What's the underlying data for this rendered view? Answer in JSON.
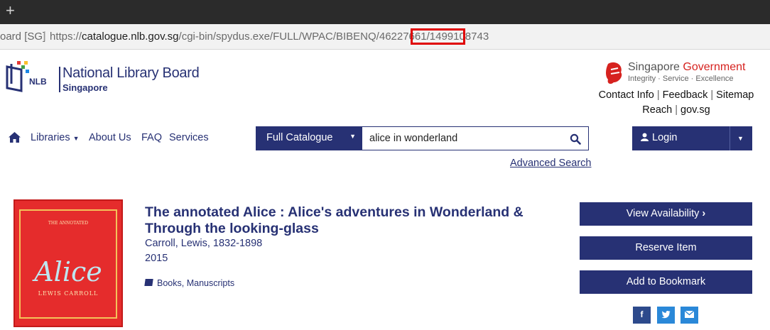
{
  "browser": {
    "new_tab": "+",
    "site_label": "oard [SG]",
    "url_prefix": "https://",
    "url_host": "catalogue.nlb.gov.sg",
    "url_path": "/cgi-bin/spydus.exe/FULL/WPAC/BIBENQ/46227661/1499108743",
    "highlight_color": "#e00000"
  },
  "header": {
    "logo_nlb": "NLB",
    "logo_name": "National Library Board",
    "logo_sub": "Singapore",
    "gov_singapore": "Singapore ",
    "gov_government": "Government",
    "gov_tagline": "Integrity · Service · Excellence",
    "links": [
      "Contact Info",
      "Feedback",
      "Sitemap",
      "Reach",
      "gov.sg"
    ]
  },
  "nav": {
    "home_icon": "home-icon",
    "libraries": "Libraries",
    "about": "About Us",
    "faq": "FAQ",
    "services": "Services"
  },
  "search": {
    "scope": "Full Catalogue",
    "query": "alice in wonderland",
    "advanced": "Advanced Search"
  },
  "login": {
    "label": "Login"
  },
  "record": {
    "cover": {
      "alice": "Alice",
      "author": "LEWIS CARROLL",
      "top": "THE ANNOTATED"
    },
    "title": "The annotated Alice : Alice's adventures in Wonderland & Through the looking-glass",
    "author": "Carroll, Lewis, 1832-1898",
    "year": "2015",
    "format_book": "Books",
    "format_sep": ", ",
    "format_ms": "Manuscripts"
  },
  "actions": {
    "view": "View Availability",
    "reserve": "Reserve Item",
    "bookmark": "Add to Bookmark"
  },
  "colors": {
    "brand": "#273174",
    "red": "#d6221f"
  }
}
